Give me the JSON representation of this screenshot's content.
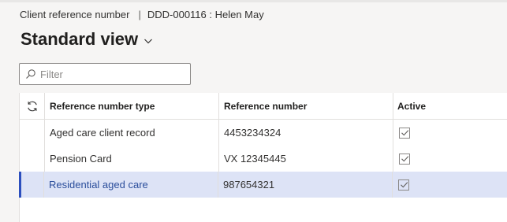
{
  "breadcrumb": {
    "page": "Client reference number",
    "separator": "|",
    "record": "DDD-000116 : Helen May"
  },
  "view": {
    "title": "Standard view"
  },
  "filter": {
    "placeholder": "Filter",
    "value": ""
  },
  "grid": {
    "columns": {
      "type": "Reference number type",
      "number": "Reference number",
      "active": "Active"
    },
    "rows": [
      {
        "type": "Aged care client record",
        "number": "4453234324",
        "active": true,
        "selected": false
      },
      {
        "type": "Pension Card",
        "number": "VX 12345445",
        "active": true,
        "selected": false
      },
      {
        "type": "Residential aged care",
        "number": "987654321",
        "active": true,
        "selected": true
      }
    ]
  },
  "colors": {
    "selected_row_bg": "#dde3f6",
    "selected_row_marker": "#2c4fbe",
    "selected_text": "#2a4d9b"
  },
  "icons": {
    "filter": "search-icon",
    "view": "chevron-down-icon",
    "refresh": "refresh-icon",
    "check": "checkmark-icon"
  }
}
